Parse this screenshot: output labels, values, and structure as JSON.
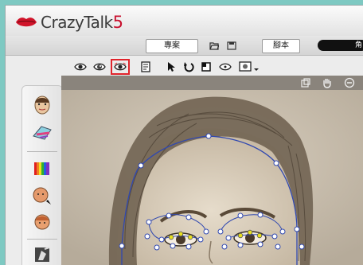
{
  "app": {
    "name": "CrazyTalk",
    "version": "5"
  },
  "menu": {
    "tab_project": "專案",
    "tab_script": "腳本",
    "tab_right": "角"
  },
  "colors": {
    "accent": "#e0242b",
    "mesh_line": "#3048b0",
    "eye_point": "#e8e020"
  },
  "toolbar": {
    "icons": [
      "eye-icon",
      "eye-open-icon",
      "eye-mesh-icon",
      "page-icon",
      "pointer-icon",
      "undo-icon",
      "square-icon",
      "eye-outline-icon",
      "preview-icon"
    ]
  },
  "sidebar": {
    "icons": [
      "face-icon",
      "mouth-icon",
      "color-icon",
      "head-rotate-icon",
      "head-icon",
      "model-icon"
    ]
  }
}
